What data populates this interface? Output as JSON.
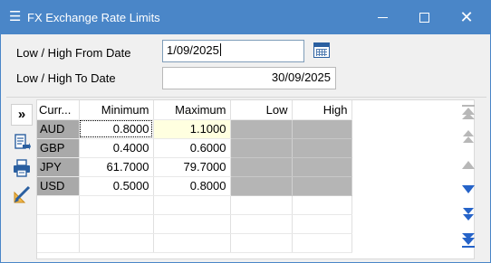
{
  "window": {
    "title": "FX Exchange Rate Limits",
    "menu_icon": "hamburger-menu-icon",
    "title_color": "#4a86c8"
  },
  "dates": {
    "from_label": "Low / High From Date",
    "from_value": "1/09/2025",
    "to_label": "Low / High To Date",
    "to_value": "30/09/2025"
  },
  "grid": {
    "columns": [
      "Curr...",
      "Minimum",
      "Maximum",
      "Low",
      "High"
    ],
    "rows": [
      {
        "currency": "AUD",
        "minimum": "0.8000",
        "maximum": "1.1000",
        "low": "",
        "high": ""
      },
      {
        "currency": "GBP",
        "minimum": "0.4000",
        "maximum": "0.6000",
        "low": "",
        "high": ""
      },
      {
        "currency": "JPY",
        "minimum": "61.7000",
        "maximum": "79.7000",
        "low": "",
        "high": ""
      },
      {
        "currency": "USD",
        "minimum": "0.5000",
        "maximum": "0.8000",
        "low": "",
        "high": ""
      }
    ],
    "selected_row": 0
  },
  "toolbar": {
    "expand_label": "»",
    "icons": [
      "expand-icon",
      "export-document-icon",
      "print-icon",
      "edit-ruler-icon"
    ]
  },
  "navigator": {
    "icons": [
      "first-record-icon",
      "page-up-icon",
      "previous-record-icon",
      "next-record-icon",
      "page-down-icon",
      "last-record-icon"
    ],
    "active_color": "#2563c8",
    "disabled_color": "#b8b8b8"
  }
}
